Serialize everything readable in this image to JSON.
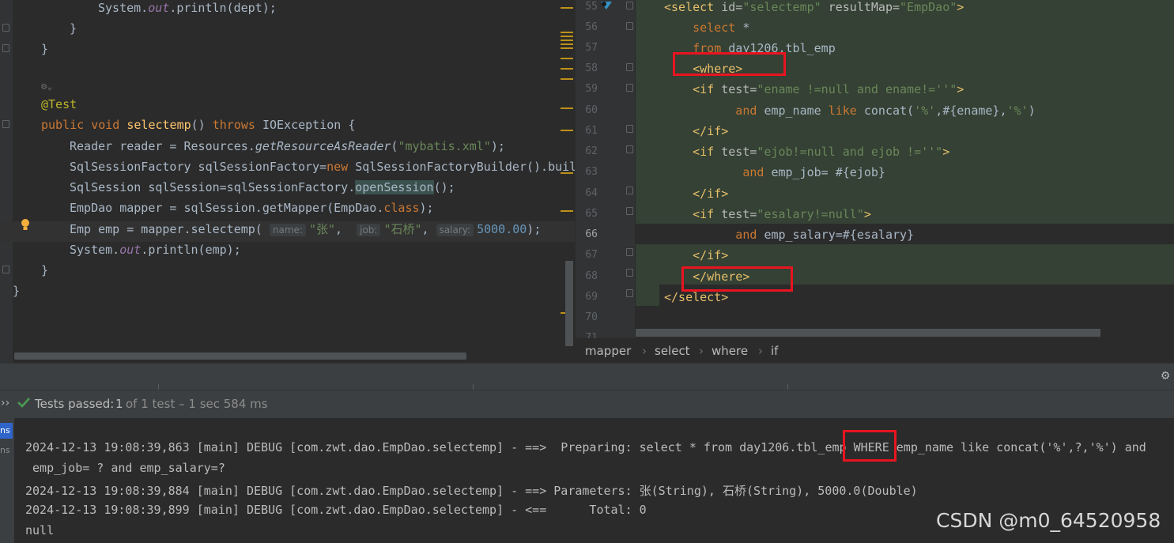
{
  "left_editor": {
    "lines": [
      {
        "segments": [
          {
            "t": "System.",
            "c": ""
          },
          {
            "t": "out",
            "c": "static"
          },
          {
            "t": ".println(dept);",
            "c": ""
          }
        ]
      },
      {
        "segments": [
          {
            "t": "}",
            "c": ""
          }
        ]
      },
      {
        "segments": [
          {
            "t": "}",
            "c": ""
          }
        ]
      },
      {
        "segments": []
      },
      {
        "segments": []
      },
      {
        "segments": [
          {
            "t": "@Test",
            "c": "ann"
          }
        ]
      },
      {
        "segments": [
          {
            "t": "public ",
            "c": "kw"
          },
          {
            "t": "void ",
            "c": "kw"
          },
          {
            "t": "selectemp",
            "c": "fn"
          },
          {
            "t": "() ",
            "c": ""
          },
          {
            "t": "throws ",
            "c": "kw"
          },
          {
            "t": "IOException {",
            "c": ""
          }
        ]
      },
      {
        "segments": [
          {
            "t": "Reader reader = Resources.",
            "c": ""
          },
          {
            "t": "getResourceAsReader",
            "c": "ital"
          },
          {
            "t": "(",
            "c": ""
          },
          {
            "t": "\"mybatis.xml\"",
            "c": "str"
          },
          {
            "t": ");",
            "c": ""
          }
        ]
      },
      {
        "segments": [
          {
            "t": "SqlSessionFactory sqlSessionFactory=",
            "c": ""
          },
          {
            "t": "new ",
            "c": "kw"
          },
          {
            "t": "SqlSessionFactoryBuilder().buil",
            "c": ""
          }
        ]
      },
      {
        "segments": [
          {
            "t": "SqlSession sqlSession=sqlSessionFactory.",
            "c": ""
          },
          {
            "t": "openSession",
            "c": "openhl"
          },
          {
            "t": "();",
            "c": ""
          }
        ]
      },
      {
        "segments": [
          {
            "t": "EmpDao mapper = sqlSession.getMapper(EmpDao.",
            "c": ""
          },
          {
            "t": "class",
            "c": "kw"
          },
          {
            "t": ");",
            "c": ""
          }
        ]
      },
      {
        "segments": [
          {
            "t": "Emp emp = mapper.selectemp( ",
            "c": ""
          },
          {
            "t": "name:",
            "c": "hint"
          },
          {
            "t": "\"张\"",
            "c": "str"
          },
          {
            "t": ",  ",
            "c": ""
          },
          {
            "t": "job:",
            "c": "hint"
          },
          {
            "t": "\"石桥\"",
            "c": "str"
          },
          {
            "t": ", ",
            "c": ""
          },
          {
            "t": "salary:",
            "c": "hint"
          },
          {
            "t": "5000.00",
            "c": "num"
          },
          {
            "t": ");",
            "c": ""
          }
        ]
      },
      {
        "segments": [
          {
            "t": "System.",
            "c": ""
          },
          {
            "t": "out",
            "c": "static"
          },
          {
            "t": ".println(emp);",
            "c": ""
          }
        ]
      },
      {
        "segments": [
          {
            "t": "}",
            "c": ""
          }
        ]
      },
      {
        "segments": [
          {
            "t": "}",
            "c": ""
          }
        ]
      }
    ]
  },
  "right_editor": {
    "line_numbers": [
      "55",
      "56",
      "57",
      "58",
      "59",
      "60",
      "61",
      "62",
      "63",
      "64",
      "65",
      "66",
      "67",
      "68",
      "69",
      "70",
      "71"
    ],
    "lines": [
      {
        "segments": [
          {
            "t": "<select ",
            "c": "tag"
          },
          {
            "t": "id=",
            "c": "attr"
          },
          {
            "t": "\"selectemp\" ",
            "c": "str"
          },
          {
            "t": "resultMap=",
            "c": "attr"
          },
          {
            "t": "\"EmpDao\"",
            "c": "str"
          },
          {
            "t": ">",
            "c": "tag"
          }
        ]
      },
      {
        "segments": [
          {
            "t": "    select ",
            "c": "sqlkw"
          },
          {
            "t": "*",
            "c": ""
          }
        ]
      },
      {
        "segments": [
          {
            "t": "    from ",
            "c": "sqlkw"
          },
          {
            "t": "day1206.tbl_emp",
            "c": ""
          }
        ]
      },
      {
        "segments": [
          {
            "t": "    ",
            "c": ""
          },
          {
            "t": "<where>",
            "c": "tag"
          }
        ]
      },
      {
        "segments": [
          {
            "t": "    ",
            "c": ""
          },
          {
            "t": "<if ",
            "c": "tag"
          },
          {
            "t": "test=",
            "c": "attr"
          },
          {
            "t": "\"ename !=null and ename!=''\"",
            "c": "str"
          },
          {
            "t": ">",
            "c": "tag"
          }
        ]
      },
      {
        "segments": [
          {
            "t": "          and ",
            "c": "sqlkw"
          },
          {
            "t": "emp_name ",
            "c": ""
          },
          {
            "t": "like ",
            "c": "sqlkw"
          },
          {
            "t": "concat(",
            "c": ""
          },
          {
            "t": "'%'",
            "c": "str"
          },
          {
            "t": ",#{ename},",
            "c": ""
          },
          {
            "t": "'%'",
            "c": "str"
          },
          {
            "t": ")",
            "c": ""
          }
        ]
      },
      {
        "segments": [
          {
            "t": "    ",
            "c": ""
          },
          {
            "t": "</if>",
            "c": "tag"
          }
        ]
      },
      {
        "segments": [
          {
            "t": "    ",
            "c": ""
          },
          {
            "t": "<if ",
            "c": "tag"
          },
          {
            "t": "test=",
            "c": "attr"
          },
          {
            "t": "\"ejob!=null and ejob !=''\"",
            "c": "str"
          },
          {
            "t": ">",
            "c": "tag"
          }
        ]
      },
      {
        "segments": [
          {
            "t": "           and ",
            "c": "sqlkw"
          },
          {
            "t": "emp_job= #{ejob}",
            "c": ""
          }
        ]
      },
      {
        "segments": [
          {
            "t": "    ",
            "c": ""
          },
          {
            "t": "</if>",
            "c": "tag"
          }
        ]
      },
      {
        "segments": [
          {
            "t": "    ",
            "c": ""
          },
          {
            "t": "<if ",
            "c": "tag"
          },
          {
            "t": "test=",
            "c": "attr"
          },
          {
            "t": "\"esalary!=null\"",
            "c": "str"
          },
          {
            "t": ">",
            "c": "tag"
          }
        ]
      },
      {
        "segments": [
          {
            "t": "          and ",
            "c": "sqlkw"
          },
          {
            "t": "emp_salary=#{esalary}",
            "c": ""
          }
        ]
      },
      {
        "segments": [
          {
            "t": "    ",
            "c": ""
          },
          {
            "t": "</if>",
            "c": "tag"
          }
        ]
      },
      {
        "segments": [
          {
            "t": "    ",
            "c": ""
          },
          {
            "t": "</where>",
            "c": "tag"
          }
        ]
      },
      {
        "segments": [
          {
            "t": "</select>",
            "c": "tag"
          }
        ]
      },
      {
        "segments": []
      },
      {
        "segments": []
      }
    ]
  },
  "breadcrumb": {
    "items": [
      "mapper",
      "select",
      "where",
      "if"
    ]
  },
  "status": {
    "passed_label": "Tests passed:",
    "passed_count": "1",
    "detail": "of 1 test – 1 sec 584 ms"
  },
  "console": {
    "lines": [
      "2024-12-13 19:08:39,863 [main] DEBUG [com.zwt.dao.EmpDao.selectemp] - ==>  Preparing: select * from day1206.tbl_emp WHERE emp_name like concat('%',?,'%') and",
      " emp_job= ? and emp_salary=?",
      "2024-12-13 19:08:39,884 [main] DEBUG [com.zwt.dao.EmpDao.selectemp] - ==> Parameters: 张(String), 石桥(String), 5000.0(Double)",
      "2024-12-13 19:08:39,899 [main] DEBUG [com.zwt.dao.EmpDao.selectemp] - <==      Total: 0",
      "null"
    ]
  },
  "side_tabs": [
    "ns",
    "ns"
  ],
  "watermark": "CSDN @m0_64520958",
  "colors": {
    "highlight_box": "#e8141f",
    "pass_green": "#499c54"
  }
}
